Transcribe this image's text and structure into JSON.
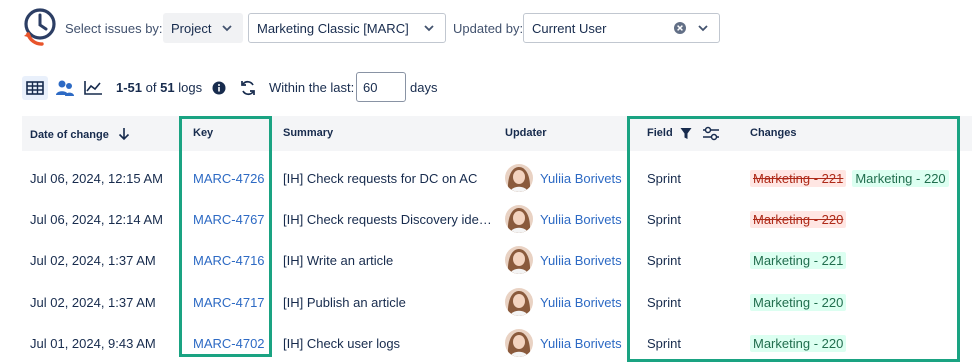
{
  "filters": {
    "select_by_label": "Select issues by:",
    "select_by_value": "Project",
    "project_value": "Marketing Classic [MARC]",
    "updated_by_label": "Updated by:",
    "updated_by_value": "Current User"
  },
  "toolbar": {
    "range": "1-51",
    "of": "of",
    "total": "51",
    "unit": "logs",
    "within_label": "Within the last:",
    "within_value": "60",
    "days_label": "days"
  },
  "table": {
    "columns": {
      "date": "Date of change",
      "key": "Key",
      "summary": "Summary",
      "updater": "Updater",
      "field": "Field",
      "changes": "Changes"
    },
    "rows": [
      {
        "date": "Jul 06, 2024, 12:15 AM",
        "key": "MARC-4726",
        "summary": "[IH] Check requests for DC on AC",
        "updater": "Yuliia Borivets",
        "field": "Sprint",
        "removed": "Marketing - 221",
        "added": "Marketing - 220"
      },
      {
        "date": "Jul 06, 2024, 12:14 AM",
        "key": "MARC-4767",
        "summary": "[IH] Check requests Discovery idea...",
        "updater": "Yuliia Borivets",
        "field": "Sprint",
        "removed": "Marketing - 220",
        "added": ""
      },
      {
        "date": "Jul 02, 2024, 1:37 AM",
        "key": "MARC-4716",
        "summary": "[IH] Write an article",
        "updater": "Yuliia Borivets",
        "field": "Sprint",
        "removed": "",
        "added": "Marketing - 221"
      },
      {
        "date": "Jul 02, 2024, 1:37 AM",
        "key": "MARC-4717",
        "summary": "[IH] Publish an article",
        "updater": "Yuliia Borivets",
        "field": "Sprint",
        "removed": "",
        "added": "Marketing - 220"
      },
      {
        "date": "Jul 01, 2024, 9:43 AM",
        "key": "MARC-4702",
        "summary": "[IH] Check user logs",
        "updater": "Yuliia Borivets",
        "field": "Sprint",
        "removed": "",
        "added": "Marketing - 220"
      }
    ]
  },
  "colors": {
    "link": "#2d6ac4",
    "highlight": "#1aa382",
    "removed_bg": "#ffe6e3",
    "added_bg": "#dcfff1"
  },
  "icons": {
    "logo": "clock-history-icon",
    "views": [
      "table-view-icon",
      "people-view-icon",
      "chart-view-icon"
    ],
    "info": "info-icon",
    "refresh": "refresh-icon",
    "sort": "arrow-down-icon",
    "filter": "filter-icon",
    "settings": "sliders-icon"
  }
}
